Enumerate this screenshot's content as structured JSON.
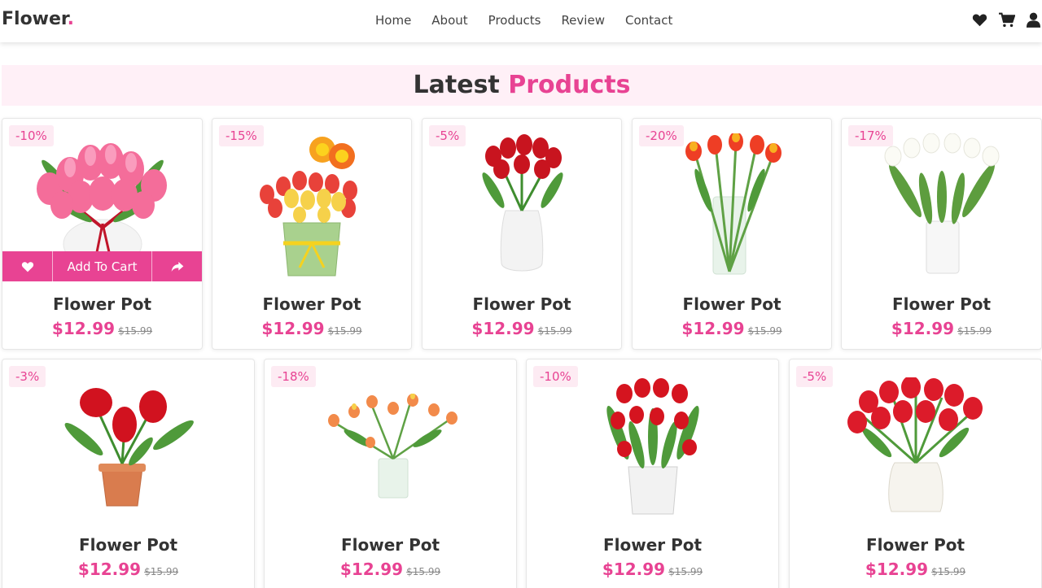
{
  "header": {
    "logo_text": "Flower",
    "logo_dot": ".",
    "nav": [
      "Home",
      "About",
      "Products",
      "Review",
      "Contact"
    ],
    "icons": [
      "heart-icon",
      "cart-icon",
      "user-icon"
    ]
  },
  "section": {
    "title_part1": "Latest",
    "title_part2": "Products"
  },
  "colors": {
    "accent": "#e84393",
    "badge_bg": "#fdebf3",
    "banner_bg": "#fff0f7"
  },
  "hover_card": {
    "add_to_cart": "Add To Cart",
    "icons": [
      "heart-icon",
      "share-icon"
    ]
  },
  "products": [
    {
      "discount": "-10%",
      "name": "Flower Pot",
      "price": "$12.99",
      "old_price": "$15.99"
    },
    {
      "discount": "-15%",
      "name": "Flower Pot",
      "price": "$12.99",
      "old_price": "$15.99"
    },
    {
      "discount": "-5%",
      "name": "Flower Pot",
      "price": "$12.99",
      "old_price": "$15.99"
    },
    {
      "discount": "-20%",
      "name": "Flower Pot",
      "price": "$12.99",
      "old_price": "$15.99"
    },
    {
      "discount": "-17%",
      "name": "Flower Pot",
      "price": "$12.99",
      "old_price": "$15.99"
    },
    {
      "discount": "-3%",
      "name": "Flower Pot",
      "price": "$12.99",
      "old_price": "$15.99"
    },
    {
      "discount": "-18%",
      "name": "Flower Pot",
      "price": "$12.99",
      "old_price": "$15.99"
    },
    {
      "discount": "-10%",
      "name": "Flower Pot",
      "price": "$12.99",
      "old_price": "$15.99"
    },
    {
      "discount": "-5%",
      "name": "Flower Pot",
      "price": "$12.99",
      "old_price": "$15.99"
    }
  ]
}
